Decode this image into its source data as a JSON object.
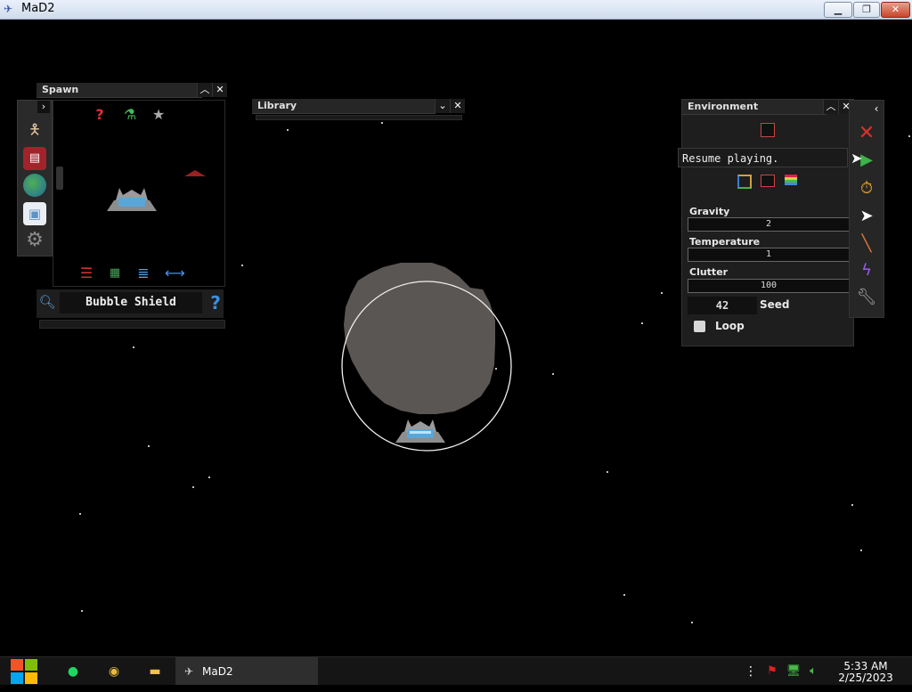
{
  "window": {
    "title": "MaD2",
    "controls": [
      "minimize",
      "maximize",
      "close"
    ]
  },
  "spawn_panel": {
    "title": "Spawn",
    "top_icons": [
      "help-icon",
      "flask-icon",
      "star-icon"
    ],
    "bottom_icons": [
      "sliders-icon",
      "grid-icon",
      "list-icon",
      "swap-icon"
    ],
    "sidebar_icons": [
      "humanoid-icon",
      "book-icon",
      "globe-icon",
      "floppy-icon",
      "gear-icon"
    ],
    "selected_item": "Bubble Shield"
  },
  "library_panel": {
    "title": "Library"
  },
  "environment_panel": {
    "title": "Environment",
    "gravity_label": "Gravity",
    "gravity_value": "2",
    "temperature_label": "Temperature",
    "temperature_value": "1",
    "clutter_label": "Clutter",
    "clutter_value": "100",
    "seed_value": "42",
    "seed_label": "Seed",
    "loop_label": "Loop",
    "loop_checked": false
  },
  "tooltip": "Resume playing.",
  "tools": [
    "close-icon",
    "play-icon",
    "stopwatch-icon",
    "cursor-icon",
    "knife-icon",
    "lightning-icon",
    "wrench-icon"
  ],
  "taskbar": {
    "app_label": "MaD2",
    "time": "5:33 AM",
    "date": "2/25/2023"
  },
  "colors": {
    "background": "#000000",
    "panel": "#1e1e1e",
    "play": "#3bb34a",
    "close_x": "#d9312b"
  }
}
